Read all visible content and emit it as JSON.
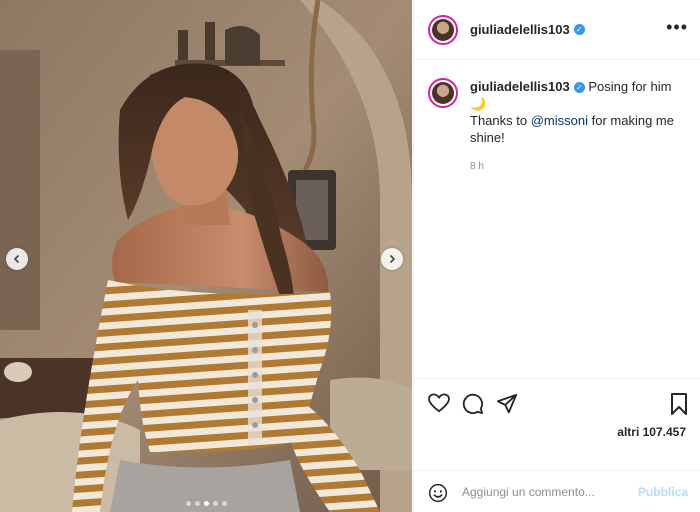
{
  "post": {
    "author": "giuliadelellis103",
    "verified_mark": "✓",
    "caption_text": "Posing for him 🌙",
    "caption_line2_prefix": "Thanks to",
    "caption_mention": "@missoni",
    "caption_line2_suffix": "for making me shine!",
    "time_ago": "8 h",
    "likes_text": "altri 107.457",
    "carousel": {
      "slide_count": 5,
      "active_index": 2
    }
  },
  "comment_box": {
    "placeholder": "Aggiungi un commento...",
    "publish_label": "Pubblica"
  },
  "icons": {
    "prev": "chevron-left-icon",
    "next": "chevron-right-icon",
    "more": "more-options-icon",
    "like": "heart-icon",
    "comment": "comment-icon",
    "share": "paper-plane-icon",
    "save": "bookmark-icon",
    "emoji": "emoji-icon"
  },
  "colors": {
    "link": "#00376b",
    "verified": "#3897f0",
    "publish_disabled": "#b2dffc",
    "muted": "#8e8e8e"
  }
}
